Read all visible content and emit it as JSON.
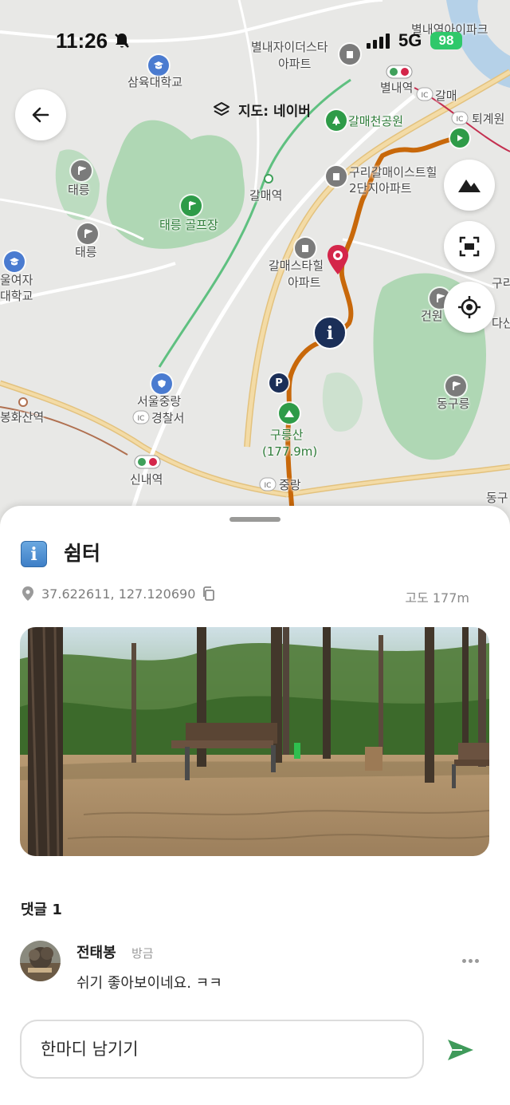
{
  "status_bar": {
    "time": "11:26",
    "network": "5G",
    "battery": "98"
  },
  "map": {
    "source_label": "지도: 네이버",
    "labels": {
      "samyuk_univ": "삼육대학교",
      "byeollae_xi_1": "별내자이더스타",
      "byeollae_xi_2": "아파트",
      "byeollae_station": "별내역",
      "byeollae_top": "별내역아이파크",
      "galmae_park": "갈매천공원",
      "galmae_station": "갈매역",
      "galmae_right": "갈매",
      "toegyewon": "퇴계원",
      "guri_galmae_1": "구리갈매이스트힐",
      "guri_galmae_2": "2단지아파트",
      "taereung_1": "태릉",
      "taereung_2": "태릉",
      "taereung_golf": "태릉 골프장",
      "galmae_starhill_1": "갈매스타힐",
      "galmae_starhill_2": "아파트",
      "womens_univ_1": "울여자",
      "womens_univ_2": "대학교",
      "geonwon": "건원",
      "guri_right": "구리",
      "dasan_right": "다산",
      "donggureung": "동구릉",
      "seoul_police_1": "서울중랑",
      "seoul_police_2": "경찰서",
      "guryongsan": "구릉산",
      "guryongsan_height": "(177.9m)",
      "bonghwasan": "봉화산역",
      "sinnae": "신내역",
      "jungnang_ic": "중랑",
      "donggu_right": "동구"
    },
    "icons": {
      "back": "arrow-left-icon",
      "layers": "layers-icon",
      "terrain": "mountain-icon",
      "fullscreen": "fullscreen-icon",
      "locate": "locate-icon"
    }
  },
  "place": {
    "title": "쉼터",
    "icon_glyph": "i",
    "coordinates": "37.622611, 127.120690",
    "altitude": "고도 177m"
  },
  "comments": {
    "header": "댓글 1",
    "items": [
      {
        "author": "전태봉",
        "time": "방금",
        "text": "쉬기 좋아보이네요. ㅋㅋ"
      }
    ]
  },
  "input": {
    "placeholder": "한마디 남기기"
  },
  "colors": {
    "route": "#c8680a",
    "accent_green": "#3f9a5a",
    "marker_red": "#d4264a",
    "info_navy": "#1b2f58"
  }
}
